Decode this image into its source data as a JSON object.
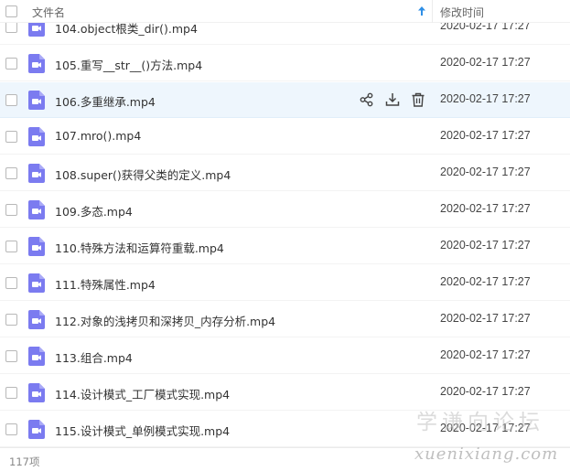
{
  "header": {
    "name_column": "文件名",
    "time_column": "修改时间",
    "sort_direction": "ascending"
  },
  "files": [
    {
      "name": "104.object根类_dir().mp4",
      "modified": "2020-02-17 17:27"
    },
    {
      "name": "105.重写__str__()方法.mp4",
      "modified": "2020-02-17 17:27"
    },
    {
      "name": "106.多重继承.mp4",
      "modified": "2020-02-17 17:27"
    },
    {
      "name": "107.mro().mp4",
      "modified": "2020-02-17 17:27"
    },
    {
      "name": "108.super()获得父类的定义.mp4",
      "modified": "2020-02-17 17:27"
    },
    {
      "name": "109.多态.mp4",
      "modified": "2020-02-17 17:27"
    },
    {
      "name": "110.特殊方法和运算符重载.mp4",
      "modified": "2020-02-17 17:27"
    },
    {
      "name": "111.特殊属性.mp4",
      "modified": "2020-02-17 17:27"
    },
    {
      "name": "112.对象的浅拷贝和深拷贝_内存分析.mp4",
      "modified": "2020-02-17 17:27"
    },
    {
      "name": "113.组合.mp4",
      "modified": "2020-02-17 17:27"
    },
    {
      "name": "114.设计模式_工厂模式实现.mp4",
      "modified": "2020-02-17 17:27"
    },
    {
      "name": "115.设计模式_单例模式实现.mp4",
      "modified": "2020-02-17 17:27"
    }
  ],
  "hovered_row": 2,
  "row_actions": [
    "share-icon",
    "download-icon",
    "delete-icon"
  ],
  "footer": {
    "count": "117项"
  },
  "watermark": {
    "cn": "学谦向论坛",
    "en": "xuenixiang.com"
  },
  "colors": {
    "file_icon": "#7b7bf0",
    "hover_row": "#eef6fd",
    "sort_arrow": "#2f8fe6"
  }
}
